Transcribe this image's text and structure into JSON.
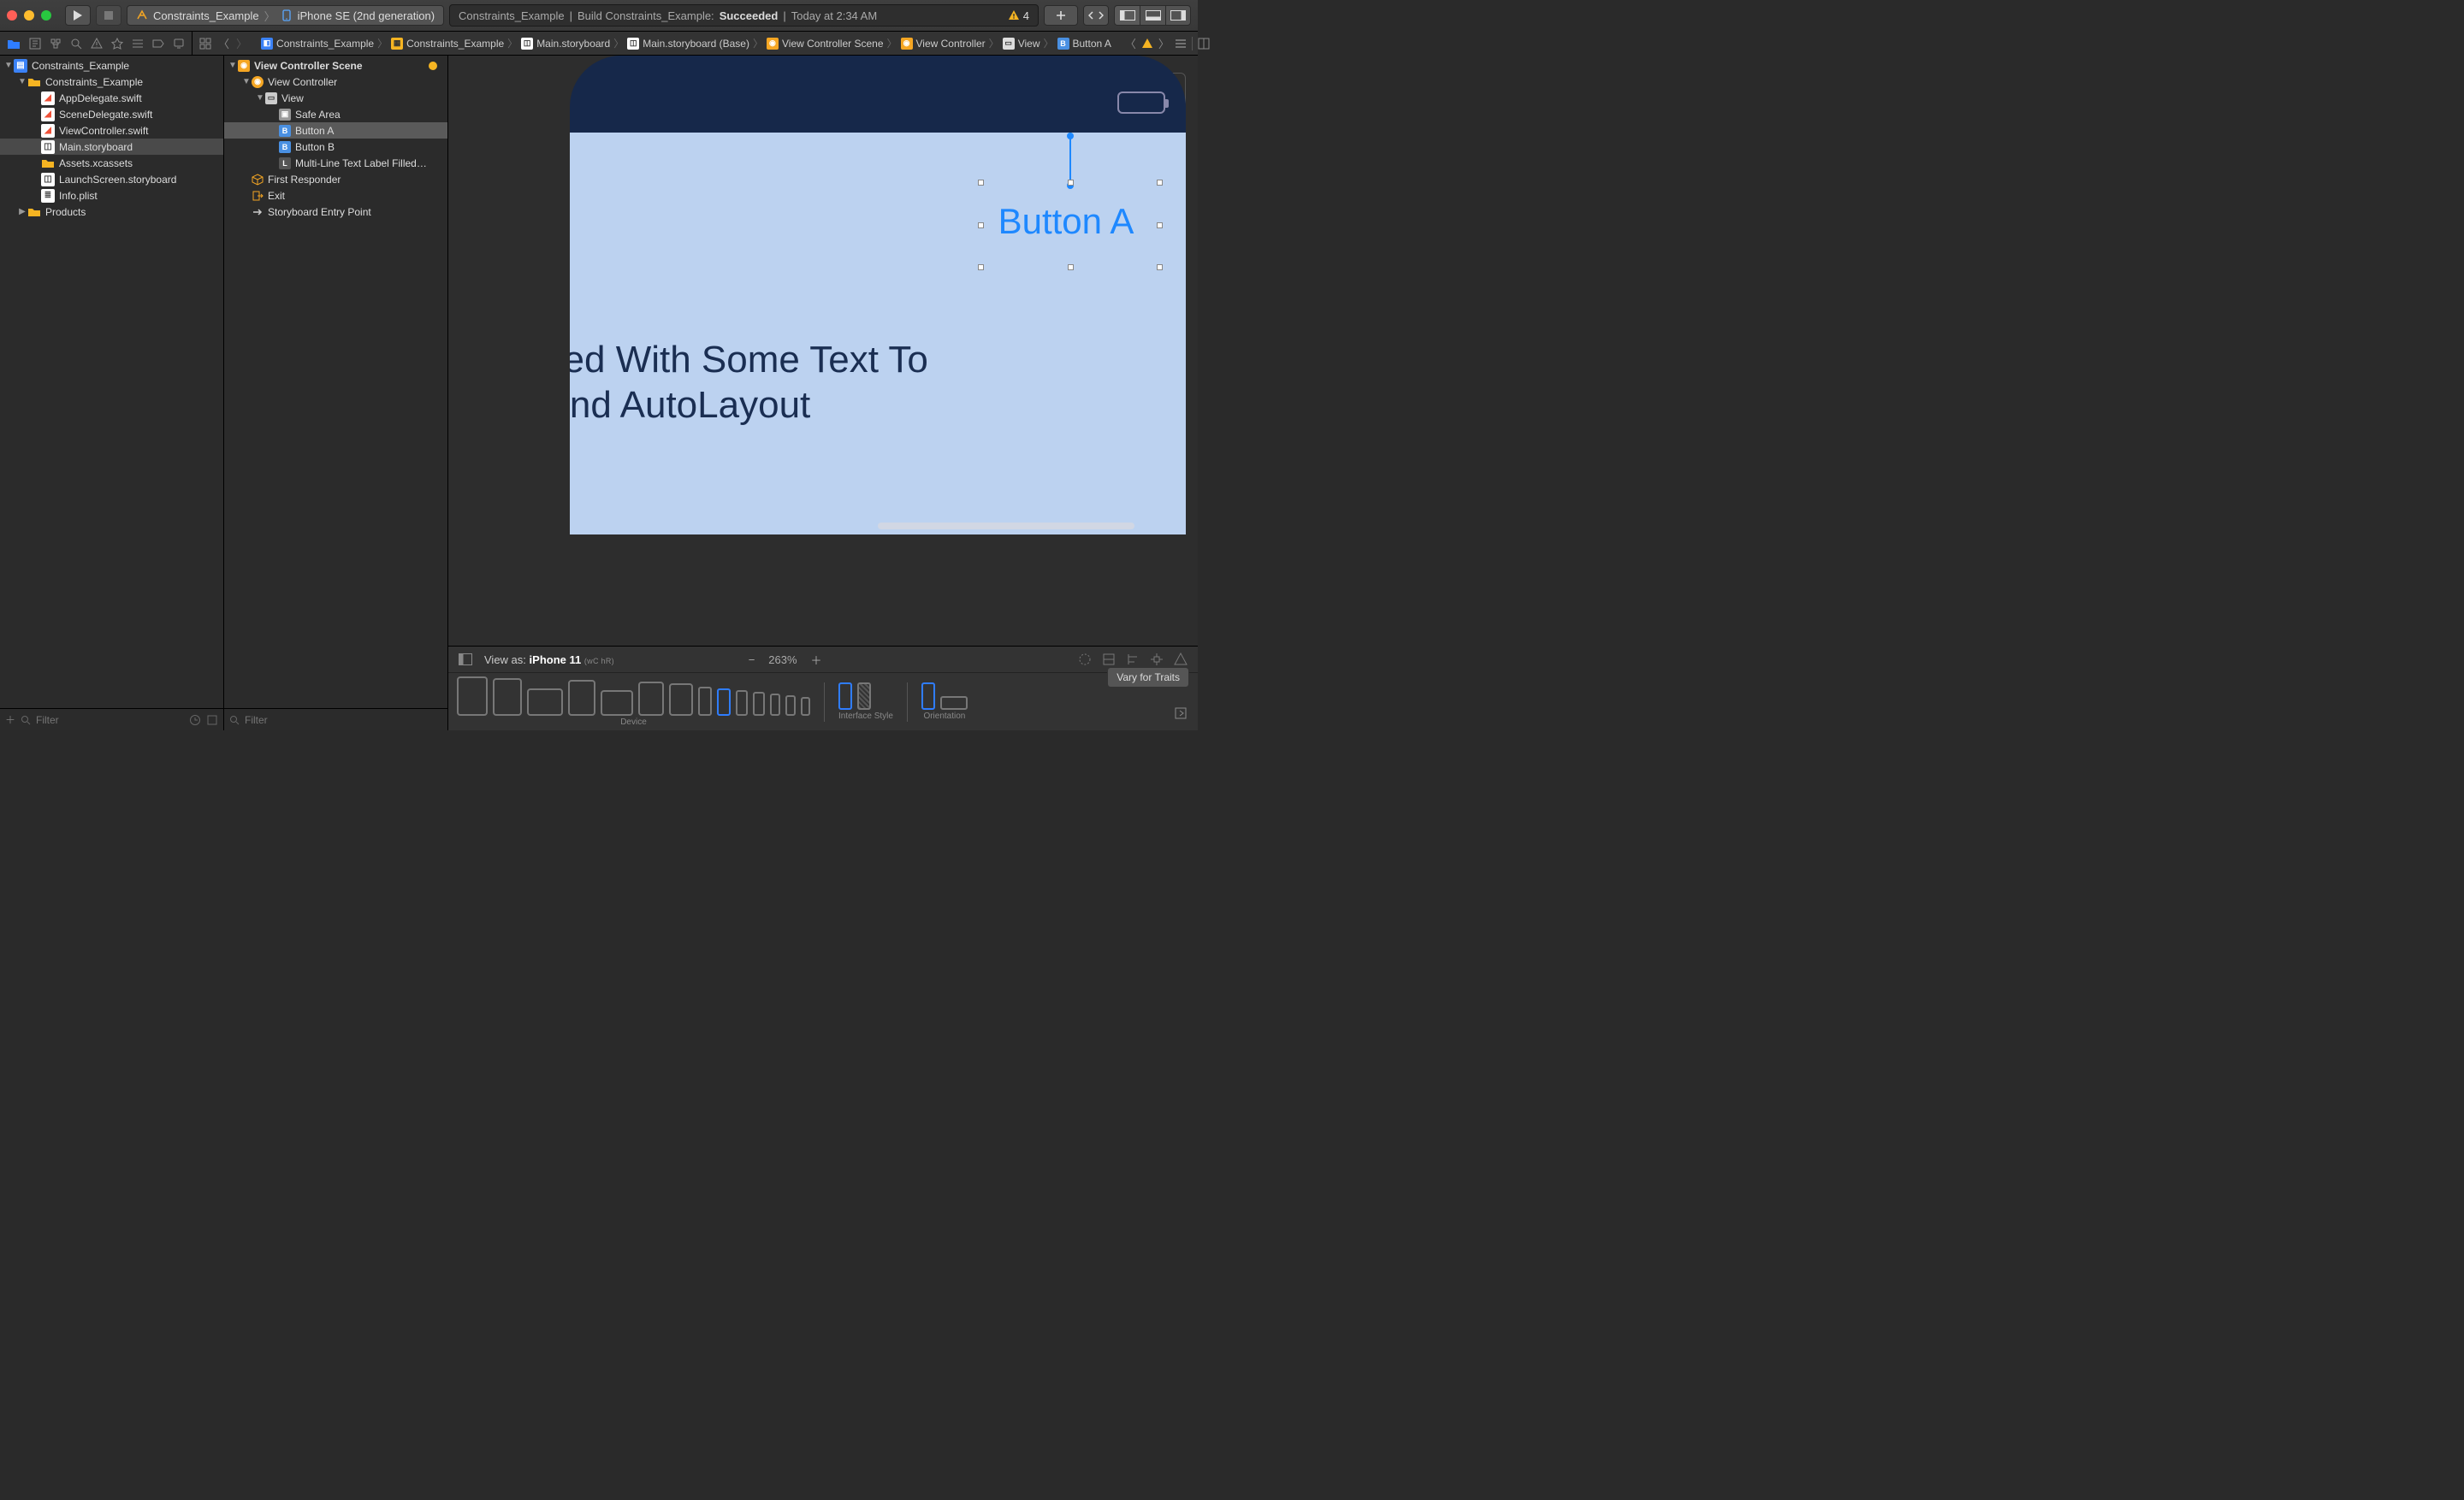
{
  "toolbar": {
    "scheme_target": "Constraints_Example",
    "scheme_device": "iPhone SE (2nd generation)"
  },
  "activity": {
    "project": "Constraints_Example",
    "action": "Build Constraints_Example:",
    "status": "Succeeded",
    "time": "Today at 2:34 AM",
    "warnings": "4"
  },
  "filter_placeholder": "Filter",
  "project_tree": {
    "root": "Constraints_Example",
    "group": "Constraints_Example",
    "files": {
      "appdelegate": "AppDelegate.swift",
      "scenedelegate": "SceneDelegate.swift",
      "viewcontroller": "ViewController.swift",
      "mainstory": "Main.storyboard",
      "assets": "Assets.xcassets",
      "launch": "LaunchScreen.storyboard",
      "plist": "Info.plist"
    },
    "products": "Products"
  },
  "outline": {
    "scene": "View Controller Scene",
    "vc": "View Controller",
    "view": "View",
    "safearea": "Safe Area",
    "buttonA": "Button A",
    "buttonB": "Button B",
    "label": "Multi-Line Text Label Filled…",
    "firstresponder": "First Responder",
    "exit": "Exit",
    "entry": "Storyboard Entry Point"
  },
  "jumpbar": {
    "p1": "Constraints_Example",
    "p2": "Constraints_Example",
    "p3": "Main.storyboard",
    "p4": "Main.storyboard (Base)",
    "p5": "View Controller Scene",
    "p6": "View Controller",
    "p7": "View",
    "p8": "Button A"
  },
  "canvas": {
    "buttonA": "Button A",
    "label_text": "xt Label Filled With Some Text To\nonstraints And AutoLayout"
  },
  "devicebar": {
    "viewas_prefix": "View as:",
    "viewas_device": "iPhone 11",
    "viewas_traits": "(wC hR)",
    "zoom": "263%",
    "labels": {
      "device": "Device",
      "style": "Interface Style",
      "orientation": "Orientation"
    },
    "vary": "Vary for Traits"
  }
}
